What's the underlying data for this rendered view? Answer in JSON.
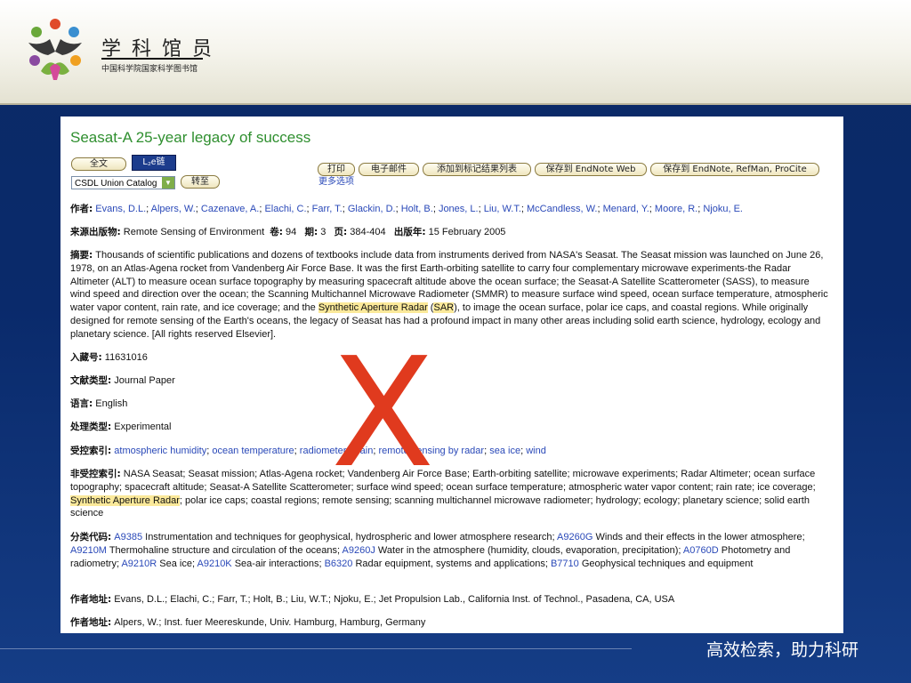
{
  "brand": {
    "title": "学科馆员",
    "subtitle": "中国科学院国家科学图书馆"
  },
  "toolbar": {
    "fulltext_label": "全文",
    "link_label": "L₂e链",
    "catalog_value": "CSDL Union Catalog",
    "goto_label": "转至",
    "print_label": "打印",
    "email_label": "电子邮件",
    "add_marked_label": "添加到标记结果列表",
    "save_endnote_web_label": "保存到 EndNote Web",
    "save_endnote_label": "保存到 EndNote, RefMan, ProCite",
    "more_options": "更多选项"
  },
  "record": {
    "title": "Seasat-A 25-year legacy of success",
    "authors_label": "作者:",
    "authors": [
      "Evans, D.L.",
      "Alpers, W.",
      "Cazenave, A.",
      "Elachi, C.",
      "Farr, T.",
      "Glackin, D.",
      "Holt, B.",
      "Jones, L.",
      "Liu, W.T.",
      "McCandless, W.",
      "Menard, Y.",
      "Moore, R.",
      "Njoku, E."
    ],
    "source_label": "来源出版物:",
    "source": "Remote Sensing of Environment",
    "volume_label": "卷:",
    "volume": "94",
    "issue_label": "期:",
    "issue": "3",
    "pages_label": "页:",
    "pages": "384-404",
    "year_label": "出版年:",
    "year": "15 February 2005",
    "abstract_label": "摘要:",
    "abstract_part1": "Thousands of scientific publications and dozens of textbooks include data from instruments derived from NASA's Seasat. The Seasat mission was launched on June 26, 1978, on an Atlas-Agena rocket from Vandenberg Air Force Base. It was the first Earth-orbiting satellite to carry four complementary microwave experiments-the Radar Altimeter (ALT) to measure ocean surface topography by measuring spacecraft altitude above the ocean surface; the Seasat-A Satellite Scatterometer (SASS), to measure wind speed and direction over the ocean; the Scanning Multichannel Microwave Radiometer (SMMR) to measure surface wind speed, ocean surface temperature, atmospheric water vapor content, rain rate, and ice coverage; and the ",
    "abstract_hl1": "Synthetic Aperture Radar",
    "abstract_mid": " (",
    "abstract_hl2": "SAR",
    "abstract_part2": "), to image the ocean surface, polar ice caps, and coastal regions. While originally designed for remote sensing of the Earth's oceans, the legacy of Seasat has had a profound impact in many other areas including solid earth science, hydrology, ecology and planetary science. [All rights reserved Elsevier].",
    "accession_label": "入藏号:",
    "accession": "11631016",
    "doctype_label": "文献类型:",
    "doctype": "Journal Paper",
    "language_label": "语言:",
    "language": "English",
    "treatment_label": "处理类型:",
    "treatment": "Experimental",
    "controlled_label": "受控索引:",
    "controlled": [
      "atmospheric humidity",
      "ocean temperature",
      "radiometers",
      "rain",
      "remote sensing by radar",
      "sea ice",
      "wind"
    ],
    "uncontrolled_label": "非受控索引:",
    "uncontrolled_part1": "NASA Seasat; Seasat mission; Atlas-Agena rocket; Vandenberg Air Force Base; Earth-orbiting satellite; microwave experiments; Radar Altimeter; ocean surface topography; spacecraft altitude; Seasat-A Satellite Scatterometer; surface wind speed; ocean surface temperature; atmospheric water vapor content; rain rate; ice coverage; ",
    "uncontrolled_hl": "Synthetic Aperture Radar",
    "uncontrolled_part2": "; polar ice caps; coastal regions; remote sensing; scanning multichannel microwave radiometer; hydrology; ecology; planetary science; solid earth science",
    "class_label": "分类代码:",
    "classes": [
      {
        "code": "A9385",
        "text": " Instrumentation and techniques for geophysical, hydrospheric and lower atmosphere research; "
      },
      {
        "code": "A9260G",
        "text": " Winds and their effects in the lower atmosphere; "
      },
      {
        "code": "A9210M",
        "text": " Thermohaline structure and circulation of the oceans; "
      },
      {
        "code": "A9260J",
        "text": " Water in the atmosphere (humidity, clouds, evaporation, precipitation); "
      },
      {
        "code": "A0760D",
        "text": " Photometry and radiometry; "
      },
      {
        "code": "A9210R",
        "text": " Sea ice; "
      },
      {
        "code": "A9210K",
        "text": " Sea-air interactions; "
      },
      {
        "code": "B6320",
        "text": " Radar equipment, systems and applications; "
      },
      {
        "code": "B7710",
        "text": " Geophysical techniques and equipment"
      }
    ],
    "address1_label": "作者地址:",
    "address1": "Evans, D.L.; Elachi, C.; Farr, T.; Holt, B.; Liu, W.T.; Njoku, E.; Jet Propulsion Lab., California Inst. of Technol., Pasadena, CA, USA",
    "address2_label": "作者地址:",
    "address2": "Alpers, W.; Inst. fuer Meereskunde, Univ. Hamburg, Hamburg, Germany"
  },
  "overlay": {
    "mark": "X"
  },
  "footer": {
    "slogan": "高效检索，助力科研"
  },
  "colors": {
    "title_green": "#2f8f2f",
    "link_blue": "#2a49b8",
    "highlight": "#fbe99a",
    "mark_red": "#e03a1e",
    "background_navy": "#0b2a66"
  }
}
